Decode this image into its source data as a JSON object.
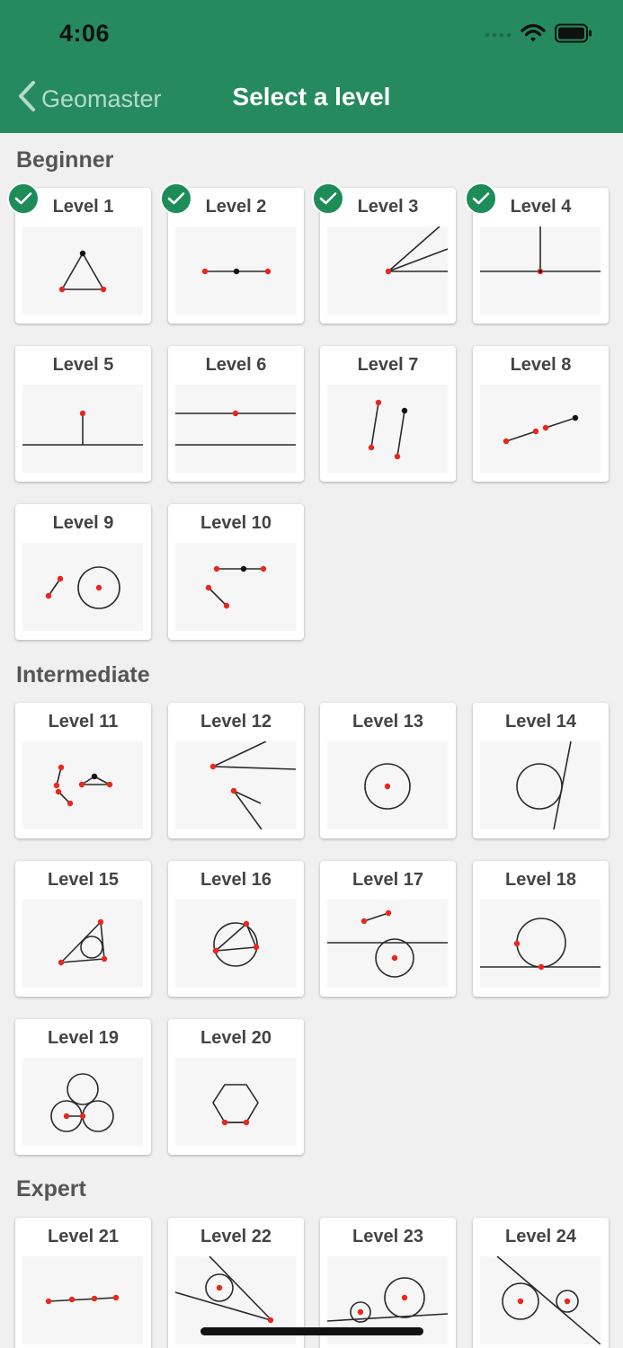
{
  "status_bar": {
    "time": "4:06"
  },
  "nav": {
    "back_label": "Geomaster",
    "title": "Select a level"
  },
  "sections": [
    {
      "label": "Beginner"
    },
    {
      "label": "Intermediate"
    },
    {
      "label": "Expert"
    }
  ],
  "levels": [
    {
      "label": "Level 1",
      "completed": true
    },
    {
      "label": "Level 2",
      "completed": true
    },
    {
      "label": "Level 3",
      "completed": true
    },
    {
      "label": "Level 4",
      "completed": true
    },
    {
      "label": "Level 5",
      "completed": false
    },
    {
      "label": "Level 6",
      "completed": false
    },
    {
      "label": "Level 7",
      "completed": false
    },
    {
      "label": "Level 8",
      "completed": false
    },
    {
      "label": "Level 9",
      "completed": false
    },
    {
      "label": "Level 10",
      "completed": false
    },
    {
      "label": "Level 11",
      "completed": false
    },
    {
      "label": "Level 12",
      "completed": false
    },
    {
      "label": "Level 13",
      "completed": false
    },
    {
      "label": "Level 14",
      "completed": false
    },
    {
      "label": "Level 15",
      "completed": false
    },
    {
      "label": "Level 16",
      "completed": false
    },
    {
      "label": "Level 17",
      "completed": false
    },
    {
      "label": "Level 18",
      "completed": false
    },
    {
      "label": "Level 19",
      "completed": false
    },
    {
      "label": "Level 20",
      "completed": false
    },
    {
      "label": "Level 21",
      "completed": false
    },
    {
      "label": "Level 22",
      "completed": false
    },
    {
      "label": "Level 23",
      "completed": false
    },
    {
      "label": "Level 24",
      "completed": false
    }
  ],
  "colors": {
    "header_green": "#268a5f",
    "check_green": "#1d8c59",
    "point_red": "#e8281e",
    "point_black": "#111111"
  }
}
